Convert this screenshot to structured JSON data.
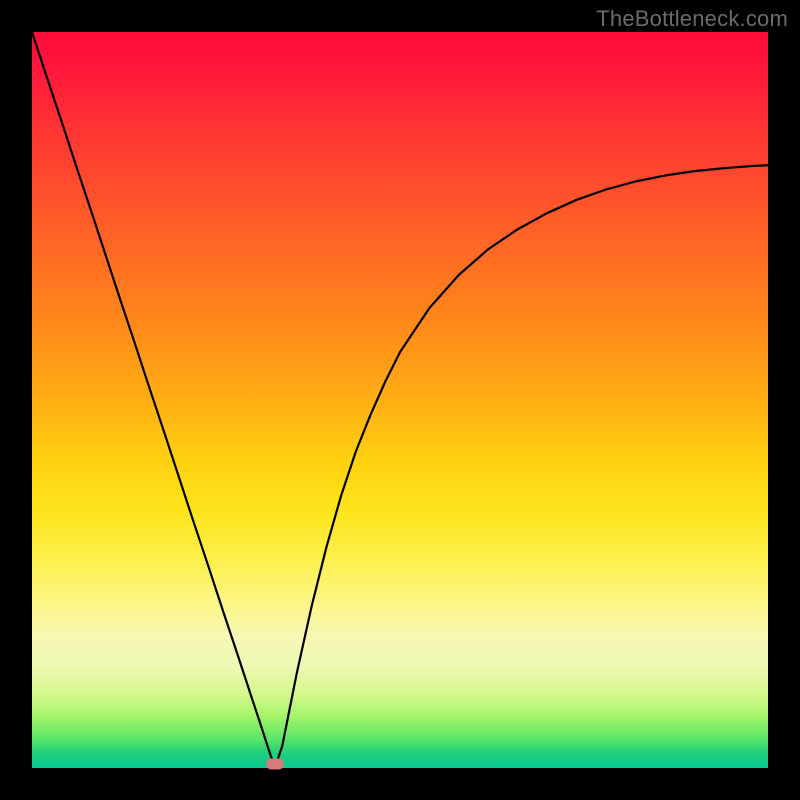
{
  "watermark": "TheBottleneck.com",
  "colors": {
    "frame": "#000000",
    "curve": "#000000",
    "marker": "#d77a7c",
    "gradient_top": "#ff0a3a",
    "gradient_bottom": "#08c98e"
  },
  "chart_data": {
    "type": "line",
    "title": "",
    "xlabel": "",
    "ylabel": "",
    "xlim": [
      0,
      100
    ],
    "ylim": [
      0,
      100
    ],
    "x": [
      0,
      2,
      4,
      6,
      8,
      10,
      12,
      14,
      16,
      18,
      20,
      22,
      24,
      26,
      28,
      30,
      31,
      32,
      33,
      34,
      35,
      36,
      38,
      40,
      42,
      44,
      46,
      48,
      50,
      54,
      58,
      62,
      66,
      70,
      74,
      78,
      82,
      86,
      90,
      94,
      98,
      100
    ],
    "y": [
      100,
      93.9,
      87.9,
      81.8,
      75.8,
      69.7,
      63.6,
      57.6,
      51.5,
      45.5,
      39.4,
      33.3,
      27.3,
      21.2,
      15.2,
      9.1,
      6.1,
      3.0,
      0.0,
      3.0,
      8.0,
      13.0,
      22.0,
      30.0,
      37.0,
      43.0,
      48.0,
      52.5,
      56.5,
      62.5,
      67.0,
      70.5,
      73.2,
      75.4,
      77.2,
      78.6,
      79.7,
      80.5,
      81.1,
      81.5,
      81.8,
      81.9
    ],
    "min_point": {
      "x": 33,
      "y": 0
    },
    "annotations": []
  }
}
